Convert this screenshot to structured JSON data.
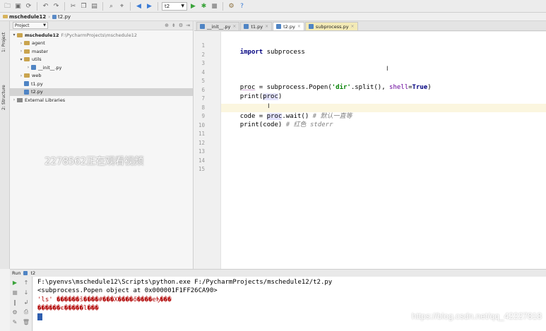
{
  "toolbar": {
    "run_config": "t2",
    "icons": [
      "open-folder-icon",
      "save-icon",
      "sync-icon",
      "undo-icon",
      "redo-icon",
      "cut-icon",
      "copy-icon",
      "paste-icon",
      "find-icon",
      "replace-icon",
      "back-icon",
      "forward-icon",
      "run-icon",
      "debug-icon",
      "stop-icon",
      "settings-icon",
      "help-icon"
    ]
  },
  "breadcrumbs": [
    "mschedule12",
    "t2.py"
  ],
  "left_strip": {
    "tab_project": "1: Project",
    "tab_structure": "2: Structure"
  },
  "project_panel": {
    "view_selector": "Project",
    "tree": [
      {
        "label": "mschedule12",
        "path": "F:\\PycharmProjects\\mschedule12",
        "level": 0,
        "type": "folder",
        "expanded": true
      },
      {
        "label": "agent",
        "level": 1,
        "type": "folder",
        "expanded": false
      },
      {
        "label": "master",
        "level": 1,
        "type": "folder",
        "expanded": false
      },
      {
        "label": "utils",
        "level": 1,
        "type": "folder",
        "expanded": true
      },
      {
        "label": "__init__.py",
        "level": 2,
        "type": "py",
        "expanded": false
      },
      {
        "label": "web",
        "level": 1,
        "type": "folder",
        "expanded": false
      },
      {
        "label": "t1.py",
        "level": 1,
        "type": "py"
      },
      {
        "label": "t2.py",
        "level": 1,
        "type": "py",
        "selected": true
      },
      {
        "label": "External Libraries",
        "level": 0,
        "type": "lib",
        "expanded": false
      }
    ]
  },
  "watermark": "2278562正在观看视频",
  "editor_tabs": [
    {
      "label": "__init__.py",
      "state": "normal"
    },
    {
      "label": "t1.py",
      "state": "normal"
    },
    {
      "label": "t2.py",
      "state": "active"
    },
    {
      "label": "subprocess.py",
      "state": "highlight"
    }
  ],
  "editor": {
    "line_numbers": [
      "1",
      "2",
      "3",
      "4",
      "5",
      "6",
      "7",
      "8",
      "9",
      "10",
      "11",
      "12",
      "13",
      "14",
      "15"
    ],
    "current_line": 8,
    "code": {
      "line1_kw1": "import",
      "line1_rest": " subprocess",
      "line5_var": "proc",
      "line5_a": " = subprocess.Popen(",
      "line5_str": "'dir'",
      "line5_b": ".split(), ",
      "line5_param": "shell",
      "line5_eq": "=",
      "line5_true": "True",
      "line5_close": ")",
      "line6_a": "print(",
      "line6_var": "proc",
      "line6_b": ")",
      "line8_a": "code = ",
      "line8_var": "proc",
      "line8_b": ".wait() ",
      "line8_cmt": "# 默认一直等",
      "line9_a": "print(code) ",
      "line9_cmt": "# 红色 stderr"
    }
  },
  "run_window": {
    "title": "Run",
    "config": "t2",
    "output": [
      "F:\\pyenvs\\mschedule12\\Scripts\\python.exe F:/PycharmProjects/mschedule12/t2.py",
      "<subprocess.Popen object at 0x000001F1FF26CA90>",
      "'ls' ������š����#���X����ő����eђ���",
      "������ϵ�����l���"
    ]
  },
  "csdn_watermark": "https://blog.csdn.net/qq_42227818"
}
